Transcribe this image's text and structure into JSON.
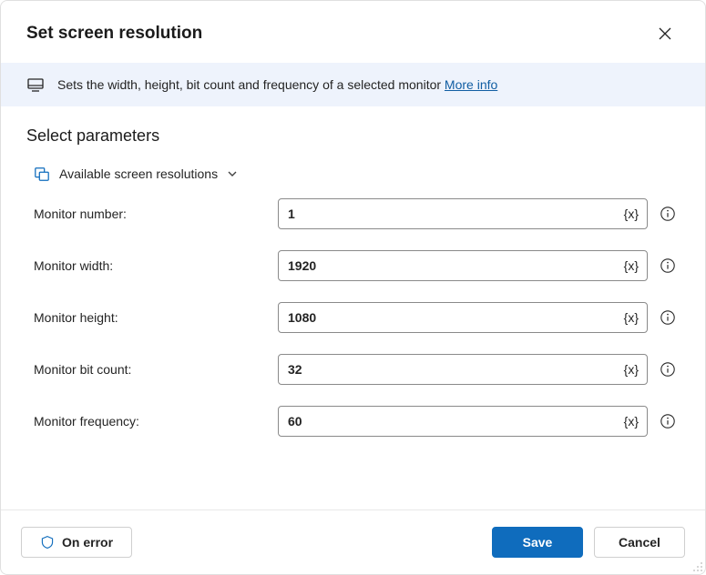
{
  "header": {
    "title": "Set screen resolution"
  },
  "banner": {
    "text": "Sets the width, height, bit count and frequency of a selected monitor ",
    "link_label": "More info"
  },
  "section": {
    "title": "Select parameters",
    "variables_label": "Available screen resolutions"
  },
  "fields": {
    "monitor_number": {
      "label": "Monitor number:",
      "value": "1"
    },
    "monitor_width": {
      "label": "Monitor width:",
      "value": "1920"
    },
    "monitor_height": {
      "label": "Monitor height:",
      "value": "1080"
    },
    "monitor_bit_count": {
      "label": "Monitor bit count:",
      "value": "32"
    },
    "monitor_frequency": {
      "label": "Monitor frequency:",
      "value": "60"
    }
  },
  "token_label": "{x}",
  "footer": {
    "on_error": "On error",
    "save": "Save",
    "cancel": "Cancel"
  }
}
